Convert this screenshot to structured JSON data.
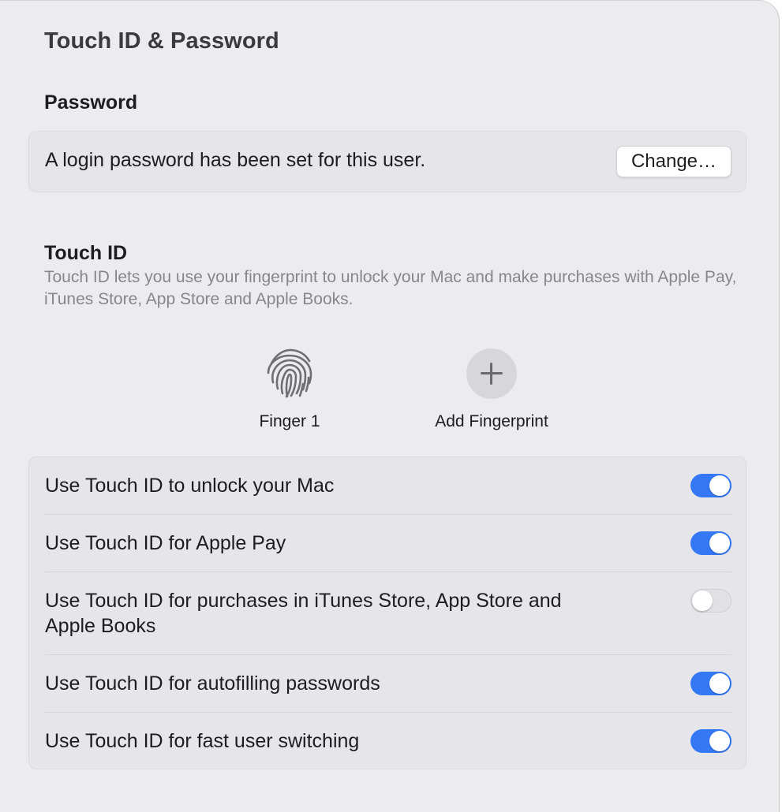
{
  "page": {
    "title": "Touch ID & Password"
  },
  "password": {
    "section_title": "Password",
    "status_text": "A login password has been set for this user.",
    "change_label": "Change…"
  },
  "touch_id": {
    "section_title": "Touch ID",
    "description": "Touch ID lets you use your fingerprint to unlock your Mac and make purchases with Apple Pay, iTunes Store, App Store and Apple Books.",
    "fingerprints": [
      {
        "label": "Finger 1",
        "icon": "fingerprint-icon"
      }
    ],
    "add_fingerprint_label": "Add Fingerprint",
    "add_icon": "plus-icon"
  },
  "options": [
    {
      "label": "Use Touch ID to unlock your Mac",
      "enabled": true
    },
    {
      "label": "Use Touch ID for Apple Pay",
      "enabled": true
    },
    {
      "label": "Use Touch ID for purchases in iTunes Store, App Store and Apple Books",
      "enabled": false
    },
    {
      "label": "Use Touch ID for autofilling passwords",
      "enabled": true
    },
    {
      "label": "Use Touch ID for fast user switching",
      "enabled": true
    }
  ],
  "colors": {
    "accent": "#3478f6",
    "window_background": "#ececef",
    "card_background": "#e6e5e9",
    "secondary_text": "#86868b"
  }
}
